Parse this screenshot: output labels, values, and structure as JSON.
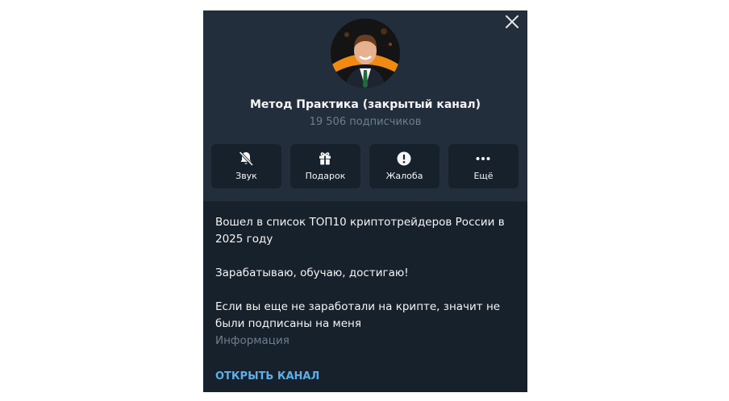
{
  "channel": {
    "title": "Метод Практика (закрытый канал)",
    "subscribers": "19 506 подписчиков"
  },
  "actions": [
    {
      "label": "Звук",
      "icon": "bell-muted-icon"
    },
    {
      "label": "Подарок",
      "icon": "gift-icon"
    },
    {
      "label": "Жалоба",
      "icon": "exclamation-icon"
    },
    {
      "label": "Ещё",
      "icon": "more-icon"
    }
  ],
  "description": {
    "paragraphs": [
      "Вошел в список ТОП10 криптотрейдеров России в 2025 году",
      "Зарабатываю, обучаю, достигаю!",
      "Если вы еще не заработали на крипте, значит не были подписаны на меня"
    ],
    "info_label": "Информация"
  },
  "open_channel_label": "ОТКРЫТЬ КАНАЛ",
  "colors": {
    "panel_bg": "#17212b",
    "header_bg": "#232e3c",
    "accent": "#5eaee8",
    "muted_text": "#6d7f8f",
    "text": "#f5f5f5"
  }
}
